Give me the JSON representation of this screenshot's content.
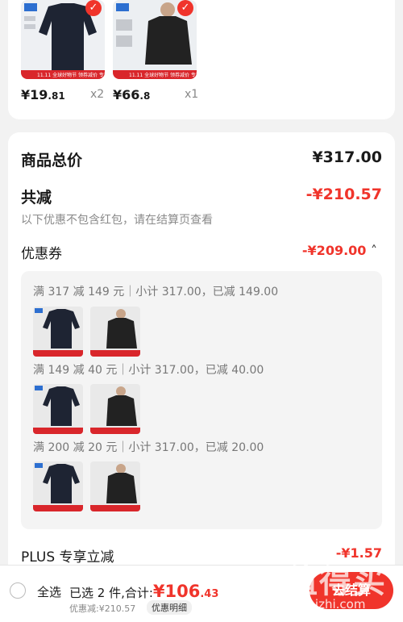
{
  "cart": {
    "items": [
      {
        "price_main": "¥19",
        "price_cents": ".81",
        "qty": "x2",
        "ribbon": "11.11 全球好物节  领券减价  专属福利",
        "image": "black-sweater",
        "tag": "snow"
      },
      {
        "price_main": "¥66",
        "price_cents": ".8",
        "qty": "x1",
        "ribbon": "11.11 全球好物节  领券减价  专属福利",
        "image": "black-puffer-jacket"
      }
    ]
  },
  "summary": {
    "total_label": "商品总价",
    "total_value": "¥317.00",
    "discount_label": "共减",
    "discount_value": "-¥210.57",
    "discount_note": "以下优惠不包含红包，请在结算页查看",
    "coupon_label": "优惠券",
    "coupon_value": "-¥209.00",
    "coupon_toggle": "˄",
    "rules": [
      {
        "text": "满 317 减 149 元｜小计 317.00，已减 149.00"
      },
      {
        "text": "满 149 减 40 元｜小计 317.00，已减 40.00"
      },
      {
        "text": "满 200 减 20 元｜小计 317.00，已减 20.00"
      }
    ],
    "plus_label": "PLUS 专享立减",
    "plus_value": "-¥1.57"
  },
  "bottom": {
    "select_all": "全选",
    "selected_text": "已选 2 件,合计:",
    "total_main": "¥106",
    "total_cents": ".43",
    "saved_text": "优惠减:¥210.57",
    "detail_button": "优惠明细",
    "checkout_button": "去结算"
  },
  "watermark": {
    "text": "值得买",
    "url": "zhizhizhi.com"
  },
  "colors": {
    "accent": "#f0342b",
    "background": "#f2f2f2",
    "card": "#ffffff"
  }
}
